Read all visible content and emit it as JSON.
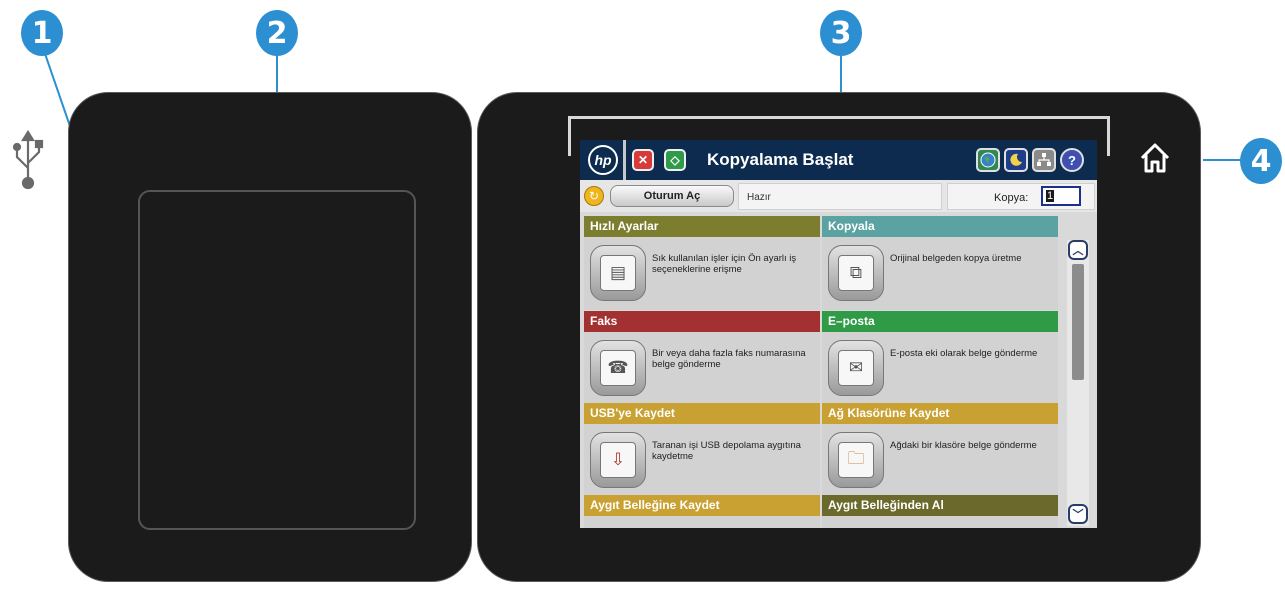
{
  "callouts": [
    "1",
    "2",
    "3",
    "4"
  ],
  "screen": {
    "title": "Kopyalama Başlat",
    "logo": "hp",
    "stop_glyph": "✕",
    "start_glyph": "◇",
    "help_glyph": "?",
    "signin_label": "Oturum Aç",
    "status_text": "Hazır",
    "copies_label": "Kopya:",
    "copies_value": "1",
    "scroll_up_glyph": "︿",
    "scroll_down_glyph": "﹀",
    "tiles": [
      {
        "title": "Hızlı Ayarlar",
        "desc": "Sık kullanılan işler için Ön ayarlı iş seçeneklerine erişme",
        "color": "#7d7d2f",
        "icon": "quick-sets-icon",
        "glyph": "▤"
      },
      {
        "title": "Kopyala",
        "desc": "Orijinal belgeden kopya üretme",
        "color": "#5aa3a2",
        "icon": "copy-icon",
        "glyph": "⧉"
      },
      {
        "title": "Faks",
        "desc": "Bir veya daha fazla faks numarasına belge gönderme",
        "color": "#a33131",
        "icon": "fax-icon",
        "glyph": "☎"
      },
      {
        "title": "E–posta",
        "desc": "E-posta eki olarak belge gönderme",
        "color": "#2f9b46",
        "icon": "email-icon",
        "glyph": "✉"
      },
      {
        "title": "USB'ye Kaydet",
        "desc": "Taranan işi USB depolama aygıtına kaydetme",
        "color": "#c9a032",
        "icon": "save-usb-icon",
        "glyph": "⇩"
      },
      {
        "title": "Ağ Klasörüne Kaydet",
        "desc": "Ağdaki bir klasöre belge gönderme",
        "color": "#c9a032",
        "icon": "save-network-folder-icon",
        "glyph": "🗀"
      },
      {
        "title": "Aygıt Belleğine Kaydet",
        "desc": "",
        "color": "#c9a032",
        "icon": "save-device-memory-icon",
        "glyph": ""
      },
      {
        "title": "Aygıt Belleğinden Al",
        "desc": "",
        "color": "#6b6a2c",
        "icon": "retrieve-device-memory-icon",
        "glyph": ""
      }
    ]
  },
  "colors": {
    "callout": "#2b8fd1",
    "panel": "#1b1b1b",
    "topbar": "#0d2b4f"
  }
}
